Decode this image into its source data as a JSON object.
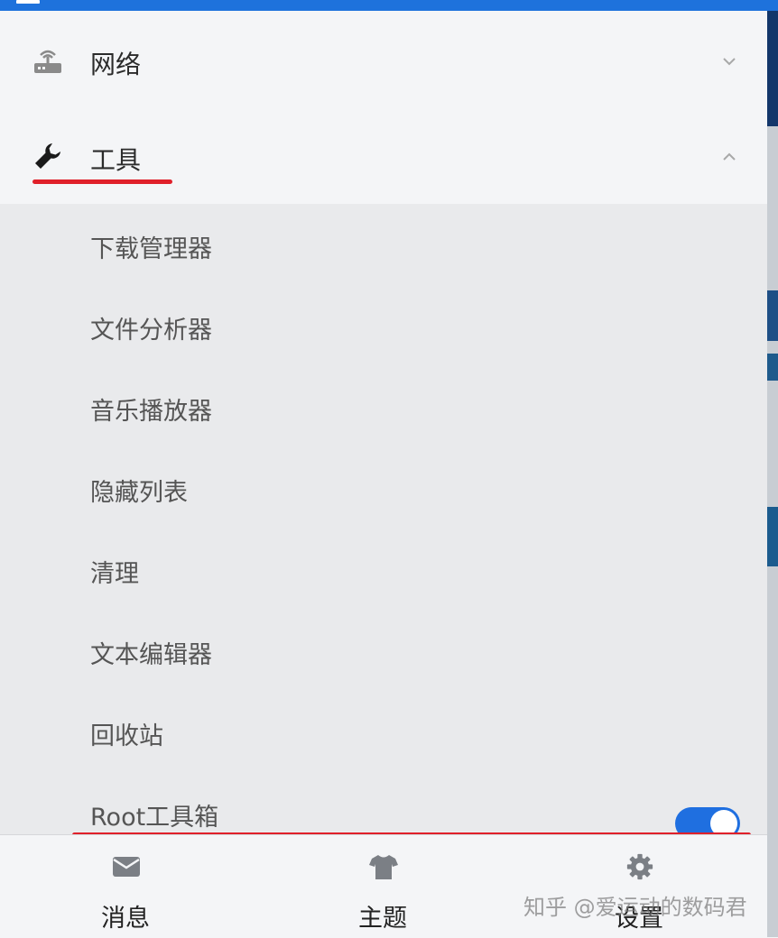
{
  "sections": {
    "network": {
      "label": "网络",
      "icon": "router-icon",
      "chevron": "chevron-down-icon"
    },
    "tools": {
      "label": "工具",
      "icon": "wrench-icon",
      "chevron": "chevron-up-icon"
    }
  },
  "tools_items": [
    {
      "label": "下载管理器"
    },
    {
      "label": "文件分析器"
    },
    {
      "label": "音乐播放器"
    },
    {
      "label": "隐藏列表"
    },
    {
      "label": "清理"
    },
    {
      "label": "文本编辑器"
    },
    {
      "label": "回收站"
    },
    {
      "label": "Root工具箱",
      "toggle": true
    }
  ],
  "bottom_nav": [
    {
      "label": "消息",
      "icon": "envelope-icon"
    },
    {
      "label": "主题",
      "icon": "tshirt-icon"
    },
    {
      "label": "设置",
      "icon": "gear-icon"
    }
  ],
  "watermark": "知乎 @爱运动的数码君",
  "colors": {
    "accent": "#1f6fe0",
    "highlight": "#e0202a"
  }
}
